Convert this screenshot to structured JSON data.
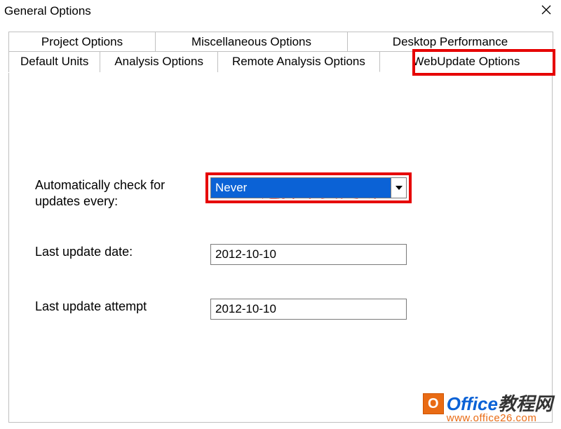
{
  "window": {
    "title": "General Options"
  },
  "tabs": {
    "row1": [
      {
        "label": "Project Options"
      },
      {
        "label": "Miscellaneous Options"
      },
      {
        "label": "Desktop Performance"
      }
    ],
    "row2": [
      {
        "label": "Default Units"
      },
      {
        "label": "Analysis Options"
      },
      {
        "label": "Remote Analysis Options"
      },
      {
        "label": "WebUpdate Options",
        "active": true
      }
    ]
  },
  "annotation": "选择不要更新",
  "form": {
    "check_label": "Automatically check for updates every:",
    "check_value": "Never",
    "last_update_label": "Last update date:",
    "last_update_value": "2012-10-10",
    "last_attempt_label": "Last update attempt",
    "last_attempt_value": "2012-10-10"
  },
  "watermark": {
    "line1_brand": "Office",
    "line1_suffix": "教程网",
    "line2": "www.office26.com"
  }
}
